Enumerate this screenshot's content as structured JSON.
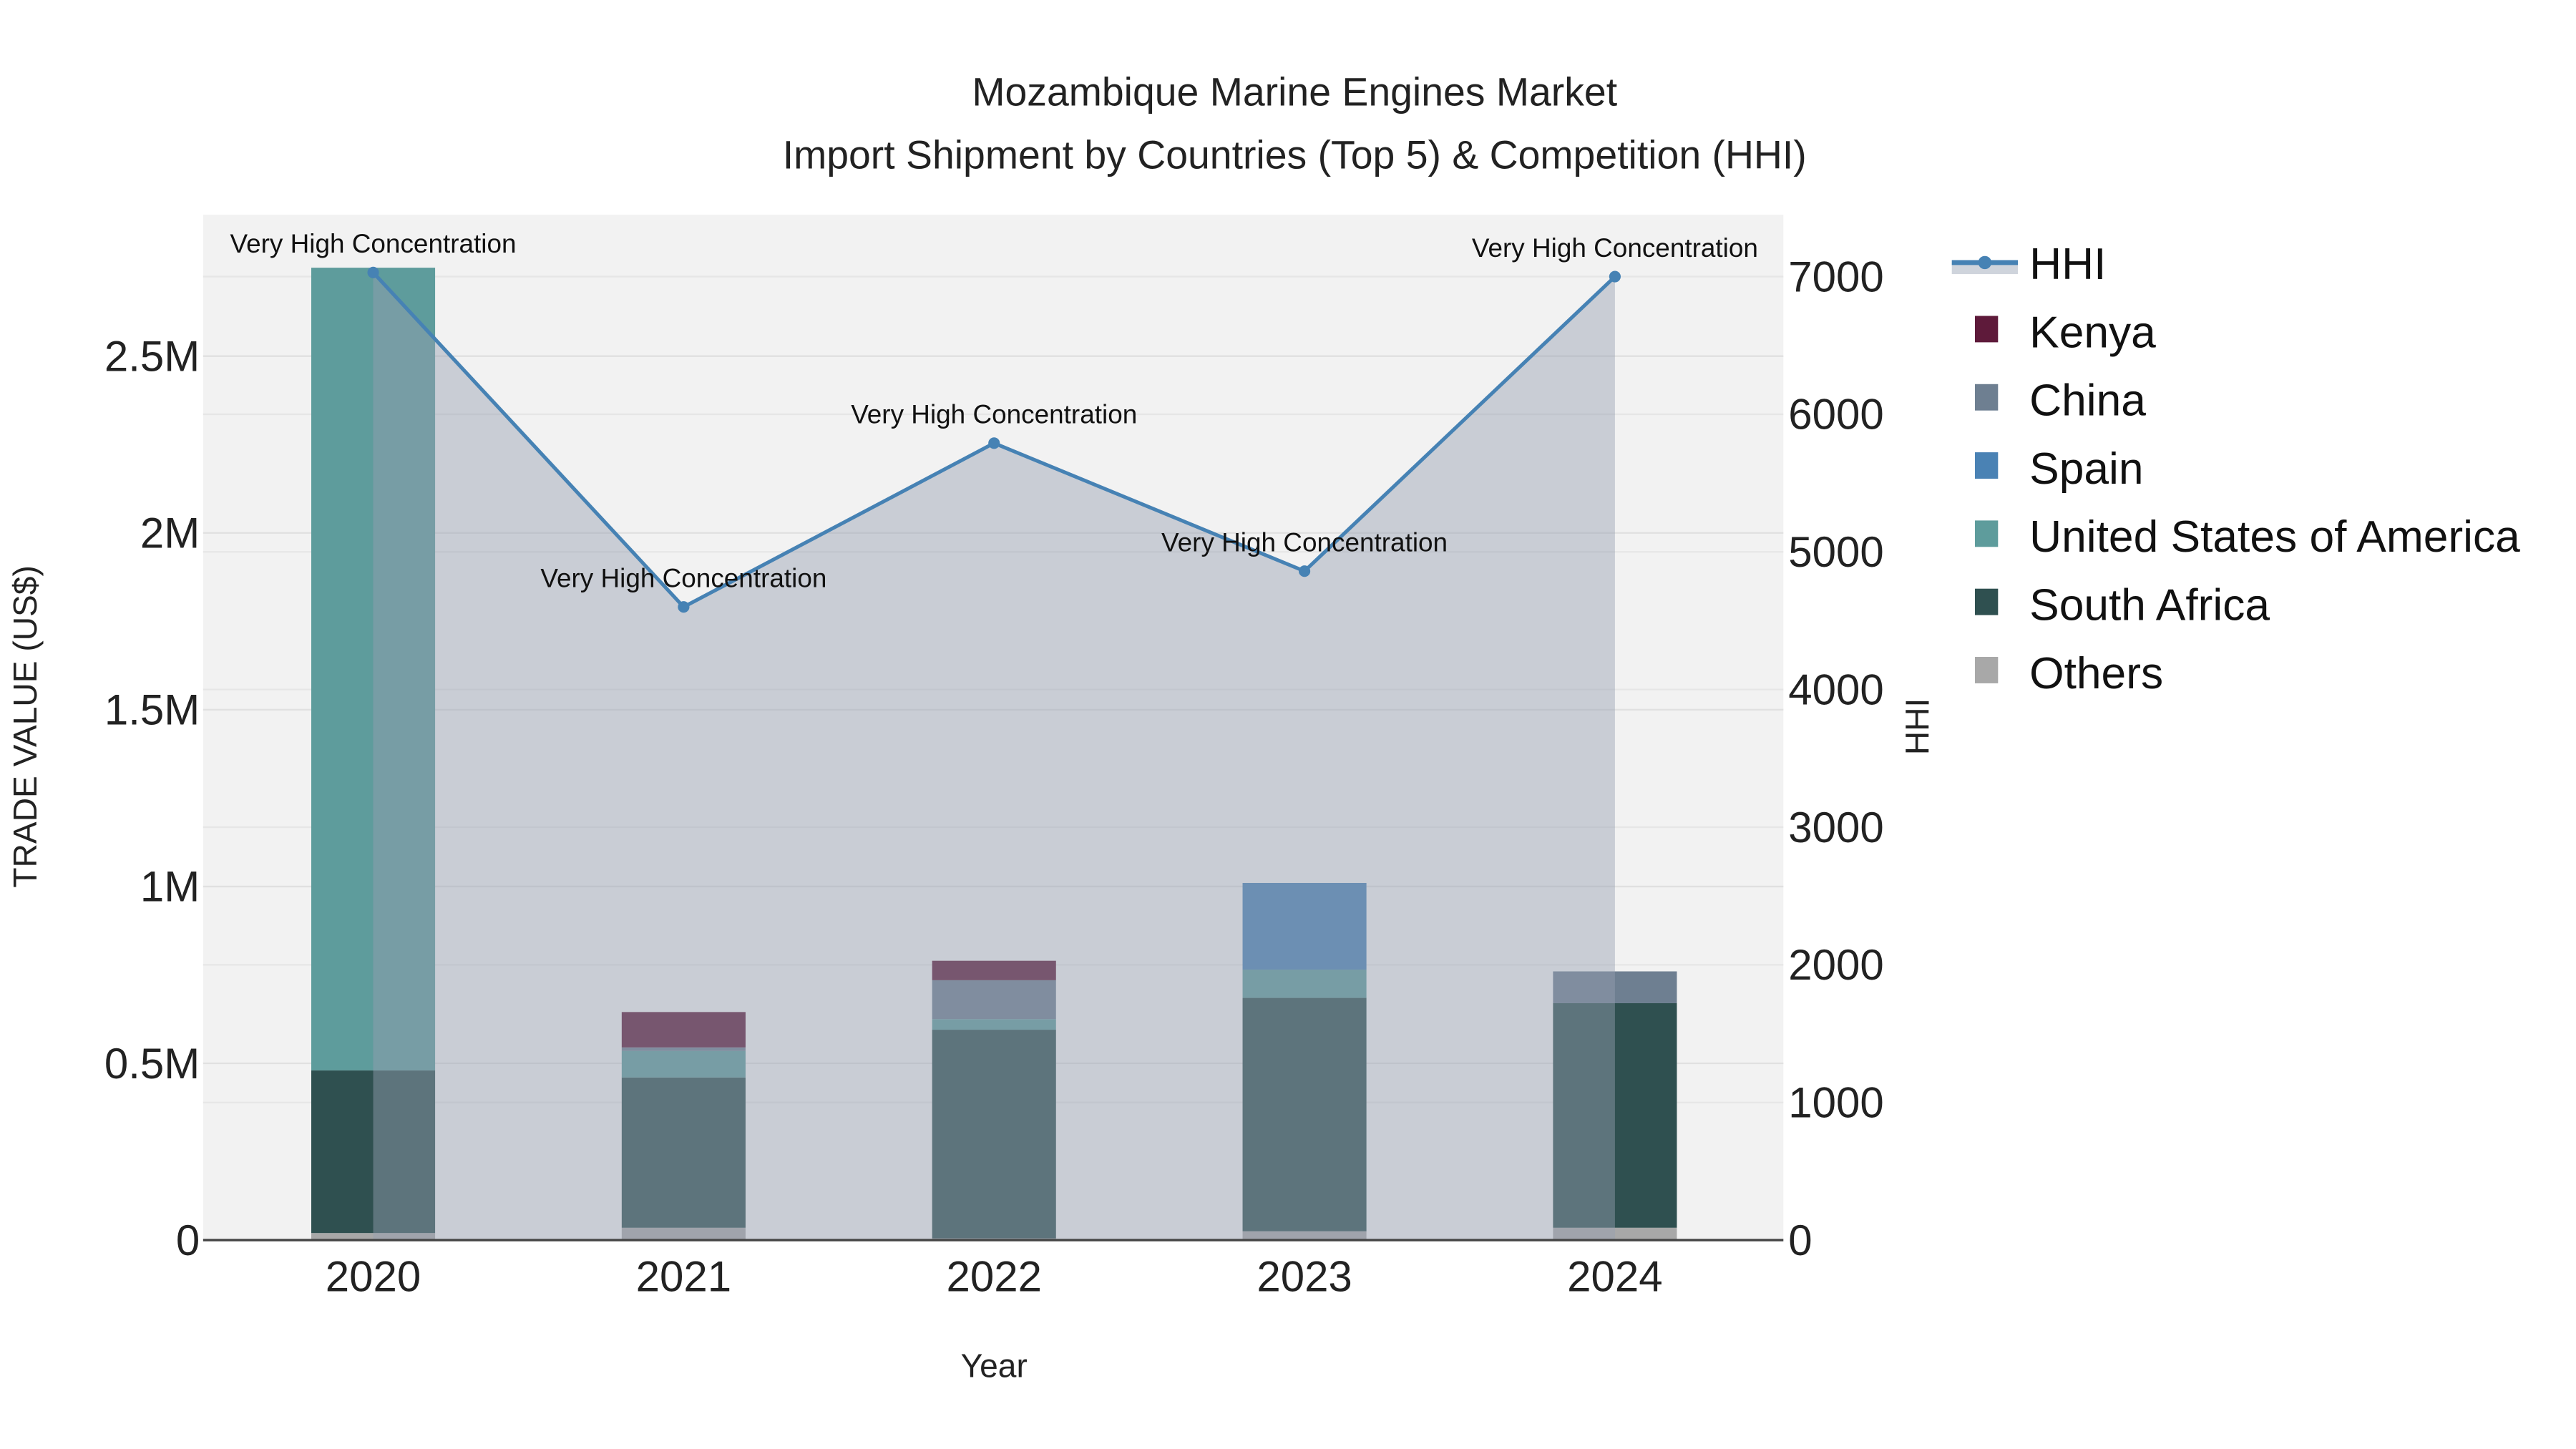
{
  "chart_data": {
    "type": "bar",
    "title_line1": "Mozambique Marine Engines Market",
    "title_line2": "Import Shipment by Countries (Top 5) & Competition (HHI)",
    "xlabel": "Year",
    "ylabel": "TRADE VALUE (US$)",
    "y2label": "HHI",
    "categories": [
      "2020",
      "2021",
      "2022",
      "2023",
      "2024"
    ],
    "ylim": [
      0,
      2.9
    ],
    "y_ticks": [
      0,
      0.5,
      1,
      1.5,
      2,
      2.5
    ],
    "y_tick_labels": [
      "0",
      "0.5M",
      "1M",
      "1.5M",
      "2M",
      "2.5M"
    ],
    "y2lim": [
      0,
      7450
    ],
    "y2_ticks": [
      0,
      1000,
      2000,
      3000,
      4000,
      5000,
      6000,
      7000
    ],
    "y2_tick_labels": [
      "0",
      "1000",
      "2000",
      "3000",
      "4000",
      "5000",
      "6000",
      "7000"
    ],
    "value_unit": "million US$",
    "series": [
      {
        "name": "Others",
        "color": "#a8a8a8",
        "values": [
          0.02,
          0.035,
          0.005,
          0.025,
          0.035
        ]
      },
      {
        "name": "South Africa",
        "color": "#2f5050",
        "values": [
          0.46,
          0.425,
          0.59,
          0.66,
          0.635
        ]
      },
      {
        "name": "United States of America",
        "color": "#5e9c9c",
        "values": [
          2.27,
          0.075,
          0.03,
          0.08,
          0
        ]
      },
      {
        "name": "Spain",
        "color": "#4a82b4",
        "values": [
          0,
          0,
          0,
          0.245,
          0
        ]
      },
      {
        "name": "China",
        "color": "#6e7f91",
        "values": [
          0,
          0.01,
          0.11,
          0,
          0.09
        ]
      },
      {
        "name": "Kenya",
        "color": "#5e1a3a",
        "values": [
          0,
          0.1,
          0.055,
          0,
          0
        ]
      }
    ],
    "hhi": {
      "name": "HHI",
      "color": "#4682b4",
      "values": [
        7030,
        4600,
        5790,
        4860,
        7000
      ],
      "annotations": [
        "Very High Concentration",
        "Very High Concentration",
        "Very High Concentration",
        "Very High Concentration",
        "Very High Concentration"
      ]
    },
    "legend": [
      "HHI",
      "Kenya",
      "China",
      "Spain",
      "United States of America",
      "South Africa",
      "Others"
    ],
    "legend_position": "right",
    "grid": true
  }
}
